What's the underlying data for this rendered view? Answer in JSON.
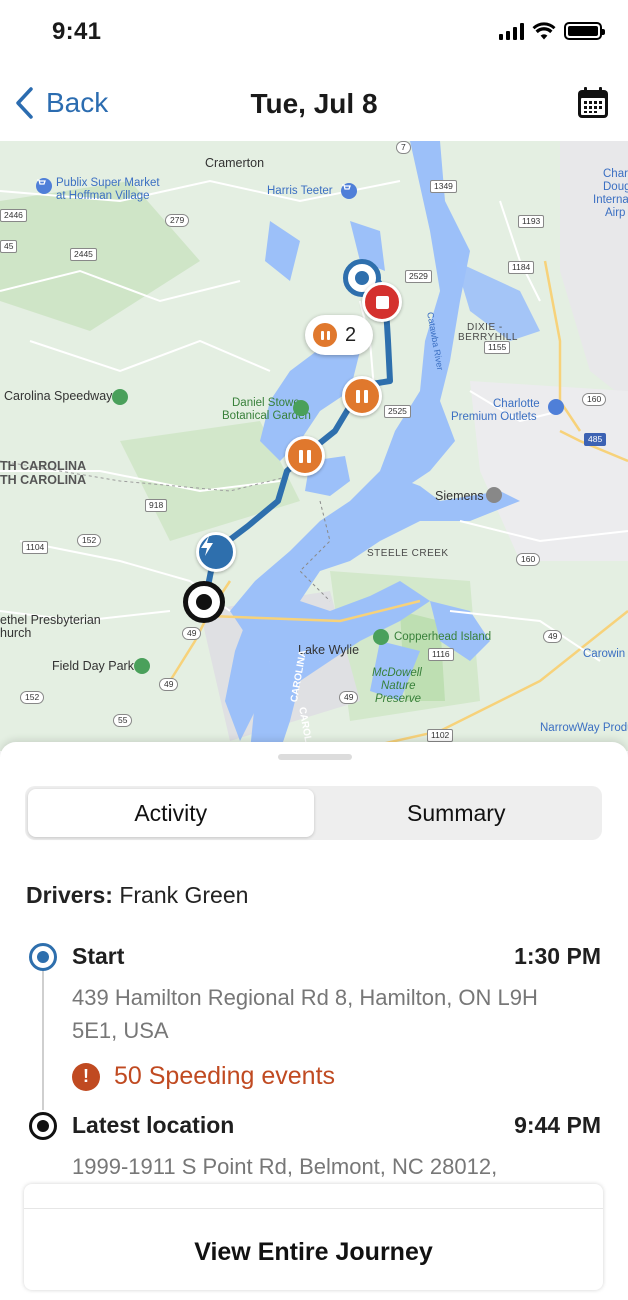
{
  "status_bar": {
    "time": "9:41"
  },
  "nav": {
    "back_label": "Back",
    "title": "Tue, Jul 8",
    "calendar_icon": "calendar-icon"
  },
  "map": {
    "places": {
      "cramerton": "Cramerton",
      "publix_1": "Publix Super Market",
      "publix_2": "at Hoffman Village",
      "harris_teeter": "Harris Teeter",
      "charlotte_douglas_1": "Char",
      "charlotte_douglas_2": "Doug",
      "charlotte_douglas_3": "Interna",
      "charlotte_douglas_4": "Airp",
      "dixie_berryhill_1": "DIXIE -",
      "dixie_berryhill_2": "BERRYHILL",
      "carolina_speedway": "Carolina Speedway",
      "daniel_stowe_1": "Daniel Stowe",
      "daniel_stowe_2": "Botanical Garden",
      "charlotte_outlets_1": "Charlotte",
      "charlotte_outlets_2": "Premium Outlets",
      "south_carolina_1": "TH CAROLINA",
      "south_carolina_2": "TH CAROLINA",
      "siemens": "Siemens",
      "steele_creek": "STEELE CREEK",
      "presbyterian_1": "ethel Presbyterian",
      "presbyterian_2": "hurch",
      "copperhead_island": "Copperhead Island",
      "field_day_park": "Field Day Park",
      "lake_wylie": "Lake Wylie",
      "mcdowell_1": "McDowell",
      "mcdowell_2": "Nature",
      "mcdowell_3": "Preserve",
      "carowinds": "Carowin",
      "narroway": "NarrowWay Produ",
      "catawba_river": "Catawba River",
      "carolina_vertical_1": "CAROLINA",
      "carolina_vertical_2": "CAROLINA"
    },
    "shields": {
      "r7": "7",
      "r1349": "1349",
      "r2446": "2446",
      "r279": "279",
      "r1193": "1193",
      "r45": "45",
      "r2445": "2445",
      "r2529": "2529",
      "r1184": "1184",
      "r1155": "1155",
      "r2525": "2525",
      "r160": "160",
      "r485": "485",
      "r918": "918",
      "r1104": "1104",
      "r152a": "152",
      "r49a": "49",
      "r1116": "1116",
      "r49b": "49",
      "r152b": "152",
      "r55": "55",
      "r49c": "49",
      "r1102": "1102",
      "r49d": "49",
      "r160b": "160"
    },
    "cluster_count": "2"
  },
  "sheet": {
    "tabs": [
      {
        "label": "Activity",
        "active": true
      },
      {
        "label": "Summary",
        "active": false
      }
    ],
    "drivers_label": "Drivers:",
    "drivers_value": "Frank Green",
    "start": {
      "title": "Start",
      "time": "1:30 PM",
      "address": "439 Hamilton Regional Rd 8, Hamilton, ON L9H 5E1, USA"
    },
    "alert": {
      "text": "50 Speeding events",
      "icon": "exclamation-icon"
    },
    "latest": {
      "title": "Latest location",
      "time": "9:44 PM",
      "address": "1999-1911 S Point Rd, Belmont, NC 28012,"
    },
    "journey_button": "View Entire Journey"
  },
  "colors": {
    "accent": "#2b6cb0",
    "route": "#2e6fad",
    "pause": "#e0782d",
    "stop": "#d4312e",
    "alert": "#c04a21",
    "water": "#9cc0f9",
    "land": "#e4efe2"
  }
}
